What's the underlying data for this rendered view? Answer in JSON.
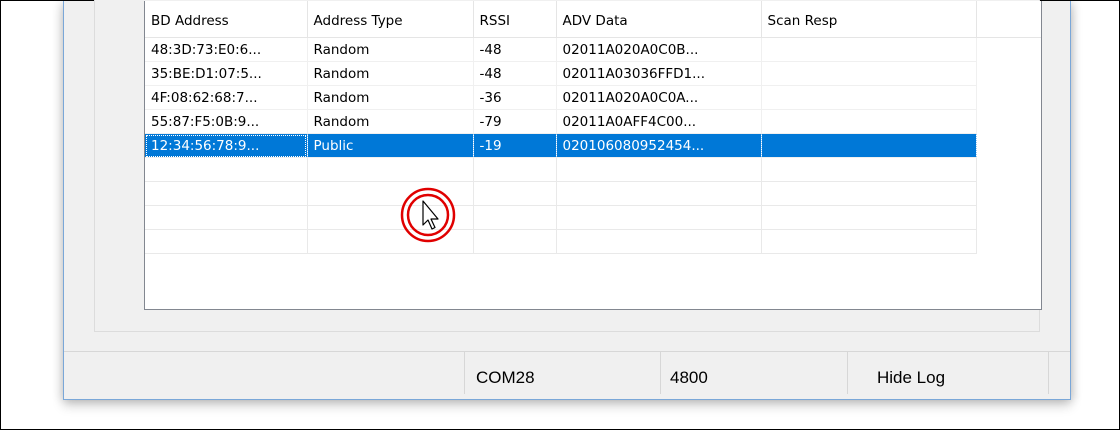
{
  "device_list": {
    "columns": [
      "BD Address",
      "Address Type",
      "RSSI",
      "ADV Data",
      "Scan Resp"
    ],
    "rows": [
      {
        "bd_address": "48:3D:73:E0:6...",
        "address_type": "Random",
        "rssi": "-48",
        "adv_data": "02011A020A0C0B...",
        "scan_resp": ""
      },
      {
        "bd_address": "35:BE:D1:07:5...",
        "address_type": "Random",
        "rssi": "-48",
        "adv_data": "02011A03036FFD1...",
        "scan_resp": ""
      },
      {
        "bd_address": "4F:08:62:68:7...",
        "address_type": "Random",
        "rssi": "-36",
        "adv_data": "02011A020A0C0A...",
        "scan_resp": ""
      },
      {
        "bd_address": "55:87:F5:0B:9...",
        "address_type": "Random",
        "rssi": "-79",
        "adv_data": "02011A0AFF4C00...",
        "scan_resp": ""
      },
      {
        "bd_address": "12:34:56:78:9...",
        "address_type": "Public",
        "rssi": "-19",
        "adv_data": "020106080952454...",
        "scan_resp": ""
      }
    ],
    "selected_row": 4
  },
  "status_bar": {
    "port": "COM28",
    "baud": "4800",
    "log_button": "Hide Log"
  },
  "colors": {
    "selection": "#0078d7",
    "click_indicator": "#e00000"
  },
  "icons": {
    "cursor": "arrow-pointer-icon",
    "click_indicator": "click-highlight-icon"
  }
}
